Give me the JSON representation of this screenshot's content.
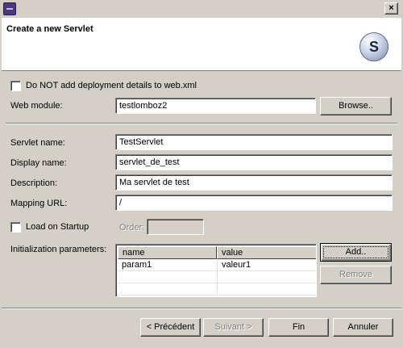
{
  "window": {
    "close_glyph": "×"
  },
  "header": {
    "title": "Create a new Servlet",
    "logo_letter": "S"
  },
  "options": {
    "no_deploy_label": "Do NOT add deployment details to web.xml",
    "no_deploy_checked": false
  },
  "web_module": {
    "label": "Web module:",
    "value": "testlomboz2",
    "browse_label": "Browse.."
  },
  "form": {
    "servlet_name_label": "Servlet name:",
    "servlet_name_value": "TestServlet",
    "display_name_label": "Display name:",
    "display_name_value": "servlet_de_test",
    "description_label": "Description:",
    "description_value": "Ma servlet de test",
    "mapping_url_label": "Mapping URL:",
    "mapping_url_value": "/",
    "load_on_startup_label": "Load on Startup",
    "load_on_startup_checked": false,
    "order_label": "Order:",
    "order_value": ""
  },
  "init_params": {
    "label": "Initialization parameters:",
    "columns": [
      "name",
      "value"
    ],
    "rows": [
      {
        "name": "param1",
        "value": "valeur1"
      }
    ],
    "add_label": "Add..",
    "remove_label": "Remove"
  },
  "footer": {
    "back_label": "< Précédent",
    "next_label": "Suivant >",
    "finish_label": "Fin",
    "cancel_label": "Annuler"
  }
}
